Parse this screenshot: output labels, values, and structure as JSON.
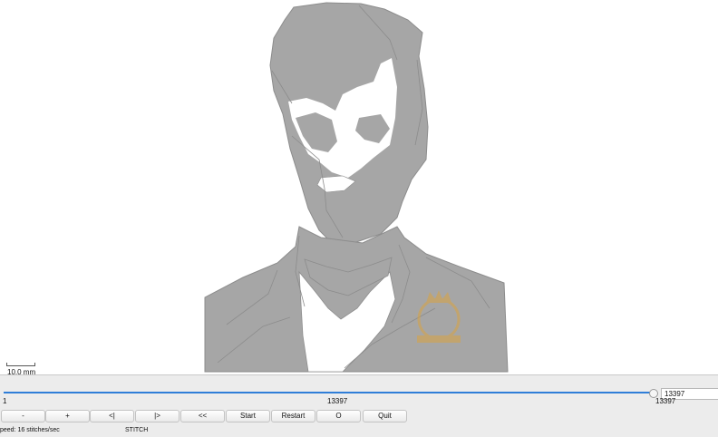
{
  "scale": {
    "label": "10.0 mm"
  },
  "progress": {
    "start": "1",
    "current": "13397",
    "total": "13397",
    "value": "13397",
    "fraction": 0.98
  },
  "buttons": {
    "minus": "-",
    "plus": "+",
    "step_back": "<|",
    "step_forward": "|>",
    "rewind": "<<",
    "start": "Start",
    "restart": "Restart",
    "o": "O",
    "quit": "Quit"
  },
  "status": {
    "speed": "peed: 16 stitches/sec",
    "mode": "STITCH"
  },
  "colors": {
    "stitch_fill": "#a6a6a6",
    "stitch_line": "#8c8c8c",
    "progress": "#2f7ed8",
    "watermark": "#d9a441"
  }
}
